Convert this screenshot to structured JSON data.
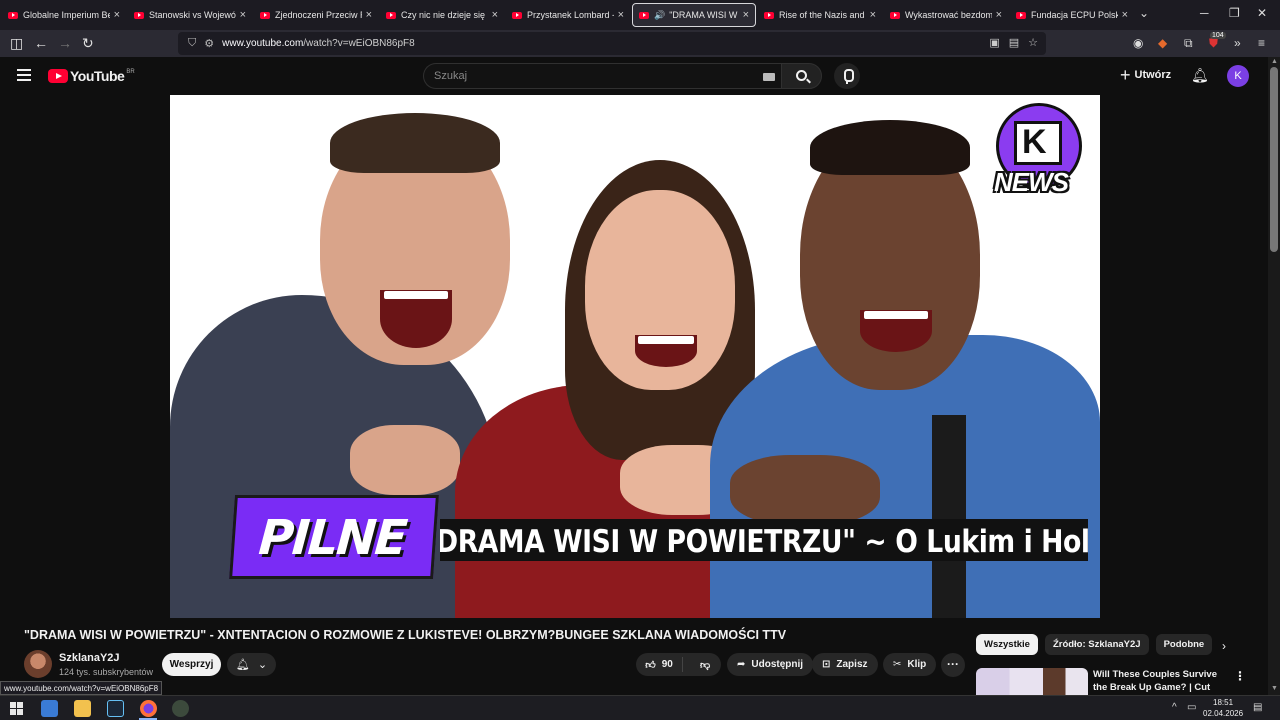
{
  "browser": {
    "tabs": [
      {
        "title": "Globalne Imperium Bezk"
      },
      {
        "title": "Stanowski vs Wojewódzk"
      },
      {
        "title": "Zjednoczeni Przeciw Ras"
      },
      {
        "title": "Czy nic nie dzieje się prz"
      },
      {
        "title": "Przystanek Lombard - Oc"
      },
      {
        "title": "\"DRAMA WISI W PO"
      },
      {
        "title": "Rise of the Nazis and Ad"
      },
      {
        "title": "Wykastrować bezdomno"
      },
      {
        "title": "Fundacja ECPU Polska: ła"
      }
    ],
    "active_tab_index": 5,
    "url_domain": "www.youtube.com",
    "url_path": "/watch?v=wEiOBN86pF8",
    "extension_badge": "104",
    "status_url": "www.youtube.com/watch?v=wEiOBN86pF8"
  },
  "youtube": {
    "logo_text": "YouTube",
    "country_code": "BR",
    "search_placeholder": "Szukaj",
    "create_label": "Utwórz",
    "avatar_letter": "K"
  },
  "video": {
    "thumbnail_badge": "PILNE",
    "thumbnail_headline": "DRAMA WISI W POWIETRZU\" ~ O Lukim i Holaku",
    "channel_logo_text": "NEWS",
    "title": "\"DRAMA WISI W POWIETRZU\" - XNTENTACION O ROZMOWIE Z LUKISTEVE! OLBRZYM?BUNGEE SZKLANA WIADOMOŚCI TTV",
    "channel_name": "SzklanaY2J",
    "subscribers": "124 tys. subskrybentów",
    "support_label": "Wesprzyj",
    "likes": "90",
    "share_label": "Udostępnij",
    "save_label": "Zapisz",
    "clip_label": "Klip"
  },
  "recommendations": {
    "chips": [
      "Wszystkie",
      "Źródło: SzklanaY2J",
      "Podobne"
    ],
    "items": [
      {
        "title": "Will These Couples Survive the Break Up Game? | Cut"
      }
    ]
  },
  "taskbar": {
    "time": "18:51",
    "date": "02.04.2026"
  },
  "colors": {
    "yt_red": "#ff0033",
    "badge_purple": "#7a2cf5",
    "avatar_purple": "#7b3fe4"
  }
}
